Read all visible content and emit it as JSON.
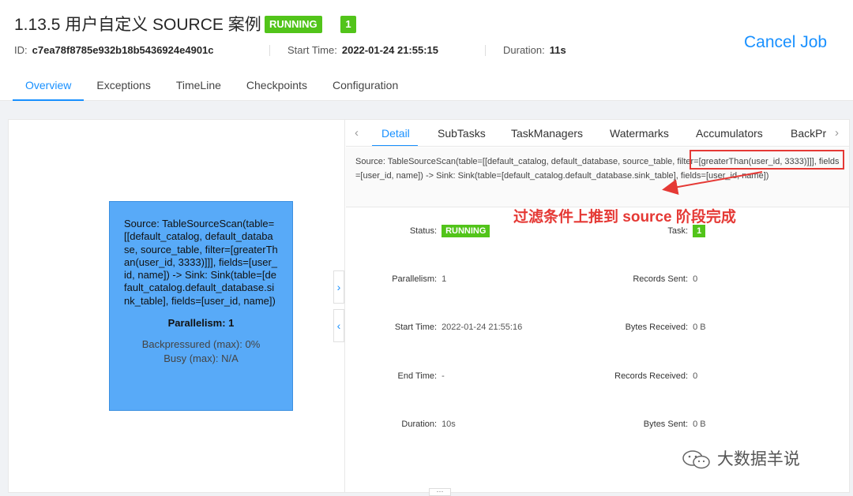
{
  "job": {
    "title": "1.13.5 用户自定义 SOURCE 案例",
    "status": "RUNNING",
    "count": "1",
    "id_label": "ID:",
    "id": "c7ea78f8785e932b18b5436924e4901c",
    "start_label": "Start Time:",
    "start_time": "2022-01-24 21:55:15",
    "duration_label": "Duration:",
    "duration": "11s",
    "cancel_label": "Cancel Job"
  },
  "tabs": [
    "Overview",
    "Exceptions",
    "TimeLine",
    "Checkpoints",
    "Configuration"
  ],
  "node": {
    "text": "Source: TableSourceScan(table=[[default_catalog, default_database, source_table, filter=[greaterThan(user_id, 3333)]]], fields=[user_id, name]) -> Sink: Sink(table=[default_catalog.default_database.sink_table], fields=[user_id, name])",
    "parallelism": "Parallelism: 1",
    "backpressured": "Backpressured (max): 0%",
    "busy": "Busy (max): N/A"
  },
  "detail_tabs": [
    "Detail",
    "SubTasks",
    "TaskManagers",
    "Watermarks",
    "Accumulators",
    "BackPr"
  ],
  "description": "Source: TableSourceScan(table=[[default_catalog, default_database, source_table, filter=[greaterThan(user_id, 3333)]]], fields=[user_id, name]) -> Sink: Sink(table=[default_catalog.default_database.sink_table], fields=[user_id, name])",
  "annotation": "过滤条件上推到 source 阶段完成",
  "details": {
    "status_label": "Status",
    "status": "RUNNING",
    "task_label": "Task",
    "task": "1",
    "parallelism_label": "Parallelism",
    "parallelism": "1",
    "records_sent_label": "Records Sent",
    "records_sent": "0",
    "start_label": "Start Time",
    "start": "2022-01-24 21:55:16",
    "bytes_received_label": "Bytes Received",
    "bytes_received": "0 B",
    "end_label": "End Time",
    "end": "-",
    "records_received_label": "Records Received",
    "records_received": "0",
    "duration_label": "Duration",
    "duration": "10s",
    "bytes_sent_label": "Bytes Sent",
    "bytes_sent": "0 B"
  },
  "watermark": "大数据羊说",
  "colors": {
    "accent": "#1890ff",
    "running": "#52c41a",
    "annotation": "#e53935",
    "node": "#58aaf8"
  }
}
